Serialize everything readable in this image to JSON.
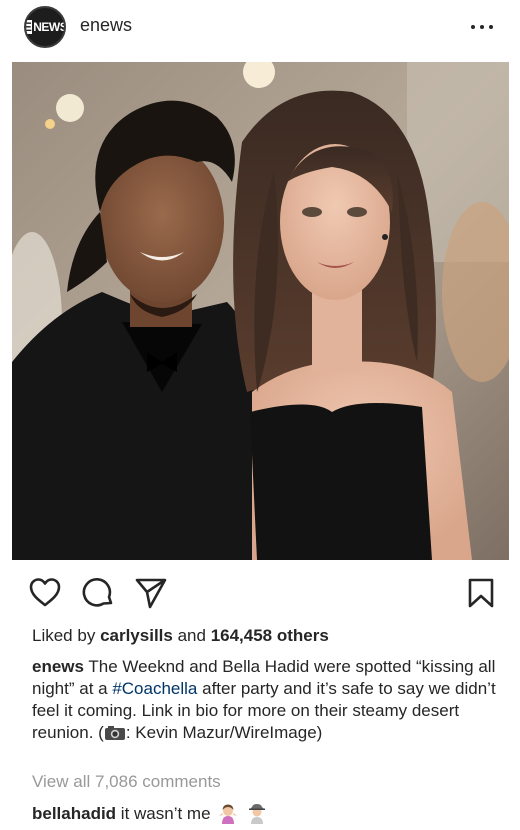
{
  "post": {
    "username": "enews",
    "avatar_text": "NEWS",
    "avatar_letter": "E",
    "likes": {
      "prefix": "Liked by",
      "user": "carlysills",
      "joiner": "and",
      "count": "164,458 others"
    },
    "caption": {
      "username": "enews",
      "text_1": " The Weeknd and Bella Hadid were spotted “kissing all night” at a ",
      "hashtag": "#Coachella",
      "text_2": " after party and it’s safe to say we didn’t feel it coming. Link in bio for more on their steamy desert reunion. (",
      "text_3": ": Kevin Mazur/WireImage)"
    },
    "view_comments": "View all 7,086 comments",
    "comment": {
      "username": "bellahadid",
      "text": " it wasn’t me"
    },
    "icons": {
      "more": "more-horizontal-icon",
      "like": "heart-icon",
      "comment": "comment-icon",
      "share": "send-icon",
      "save": "bookmark-icon",
      "camera": "camera-icon",
      "emoji_1": "woman-shrugging-emoji",
      "emoji_2": "detective-emoji"
    },
    "colors": {
      "text": "#262626",
      "muted": "#999999",
      "hashtag": "#003569",
      "background": "#ffffff"
    }
  }
}
